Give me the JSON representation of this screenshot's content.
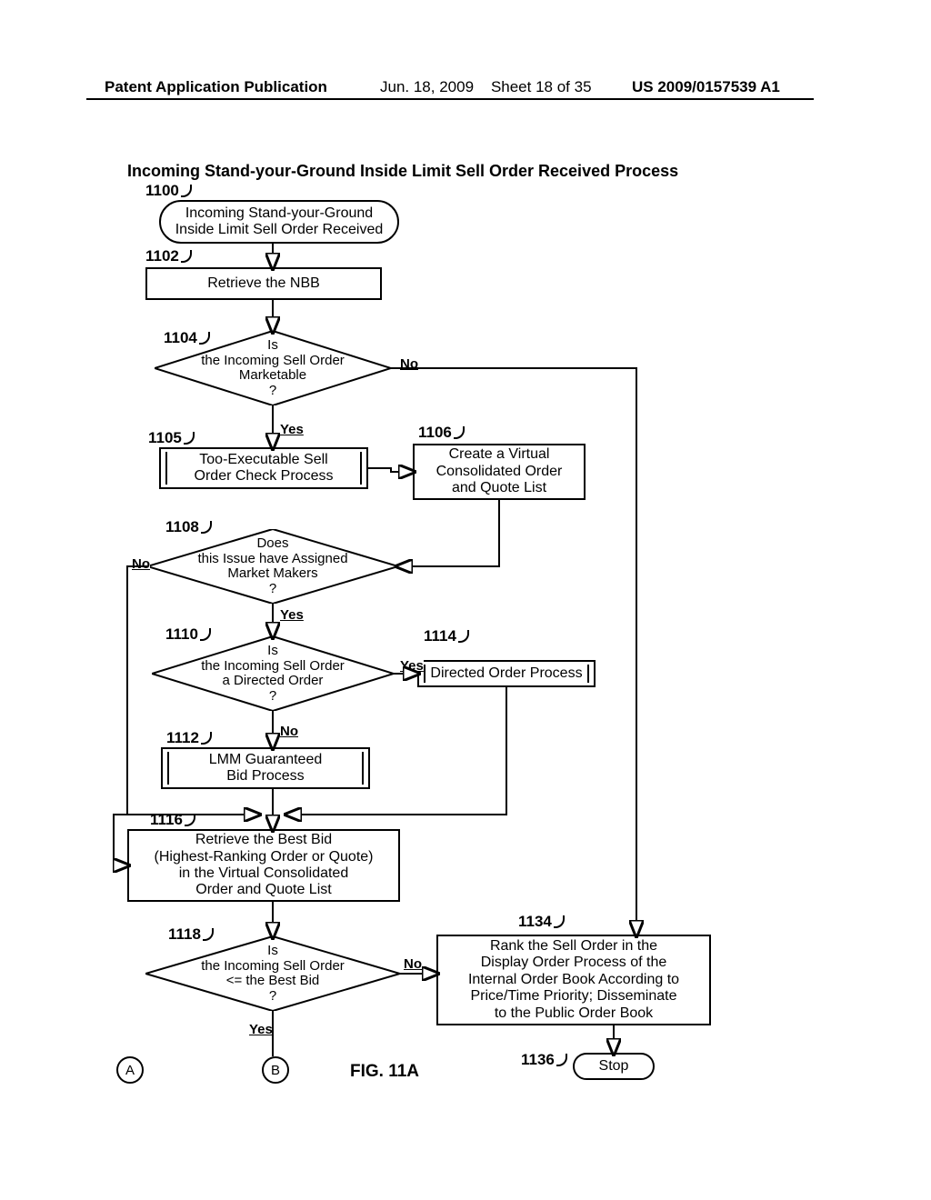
{
  "header": {
    "left": "Patent Application Publication",
    "date": "Jun. 18, 2009",
    "sheet": "Sheet 18 of 35",
    "pubno": "US 2009/0157539 A1"
  },
  "title": "Incoming Stand-your-Ground Inside Limit Sell Order Received Process",
  "refs": {
    "r1100": "1100",
    "r1102": "1102",
    "r1104": "1104",
    "r1105": "1105",
    "r1106": "1106",
    "r1108": "1108",
    "r1110": "1110",
    "r1112": "1112",
    "r1114": "1114",
    "r1116": "1116",
    "r1118": "1118",
    "r1134": "1134",
    "r1136": "1136"
  },
  "nodes": {
    "n1100": "Incoming Stand-your-Ground\nInside Limit Sell Order Received",
    "n1102": "Retrieve the NBB",
    "n1104": "Is\nthe Incoming Sell Order\nMarketable\n?",
    "n1105": "Too-Executable Sell\nOrder Check Process",
    "n1106": "Create a Virtual\nConsolidated Order\nand Quote List",
    "n1108": "Does\nthis Issue have Assigned\nMarket Makers\n?",
    "n1110": "Is\nthe Incoming Sell Order\na Directed Order\n?",
    "n1112": "LMM Guaranteed\nBid Process",
    "n1114": "Directed Order Process",
    "n1116": "Retrieve the Best Bid\n(Highest-Ranking Order or Quote)\nin the Virtual Consolidated\nOrder and Quote List",
    "n1118": "Is\nthe Incoming Sell Order\n<= the Best Bid\n?",
    "n1134": "Rank the Sell Order in the\nDisplay Order Process of the\nInternal Order Book According to\nPrice/Time Priority; Disseminate\nto the Public Order Book",
    "n1136": "Stop"
  },
  "labels": {
    "yes": "Yes",
    "no": "No"
  },
  "connectors": {
    "a": "A",
    "b": "B"
  },
  "figure": "FIG. 11A"
}
